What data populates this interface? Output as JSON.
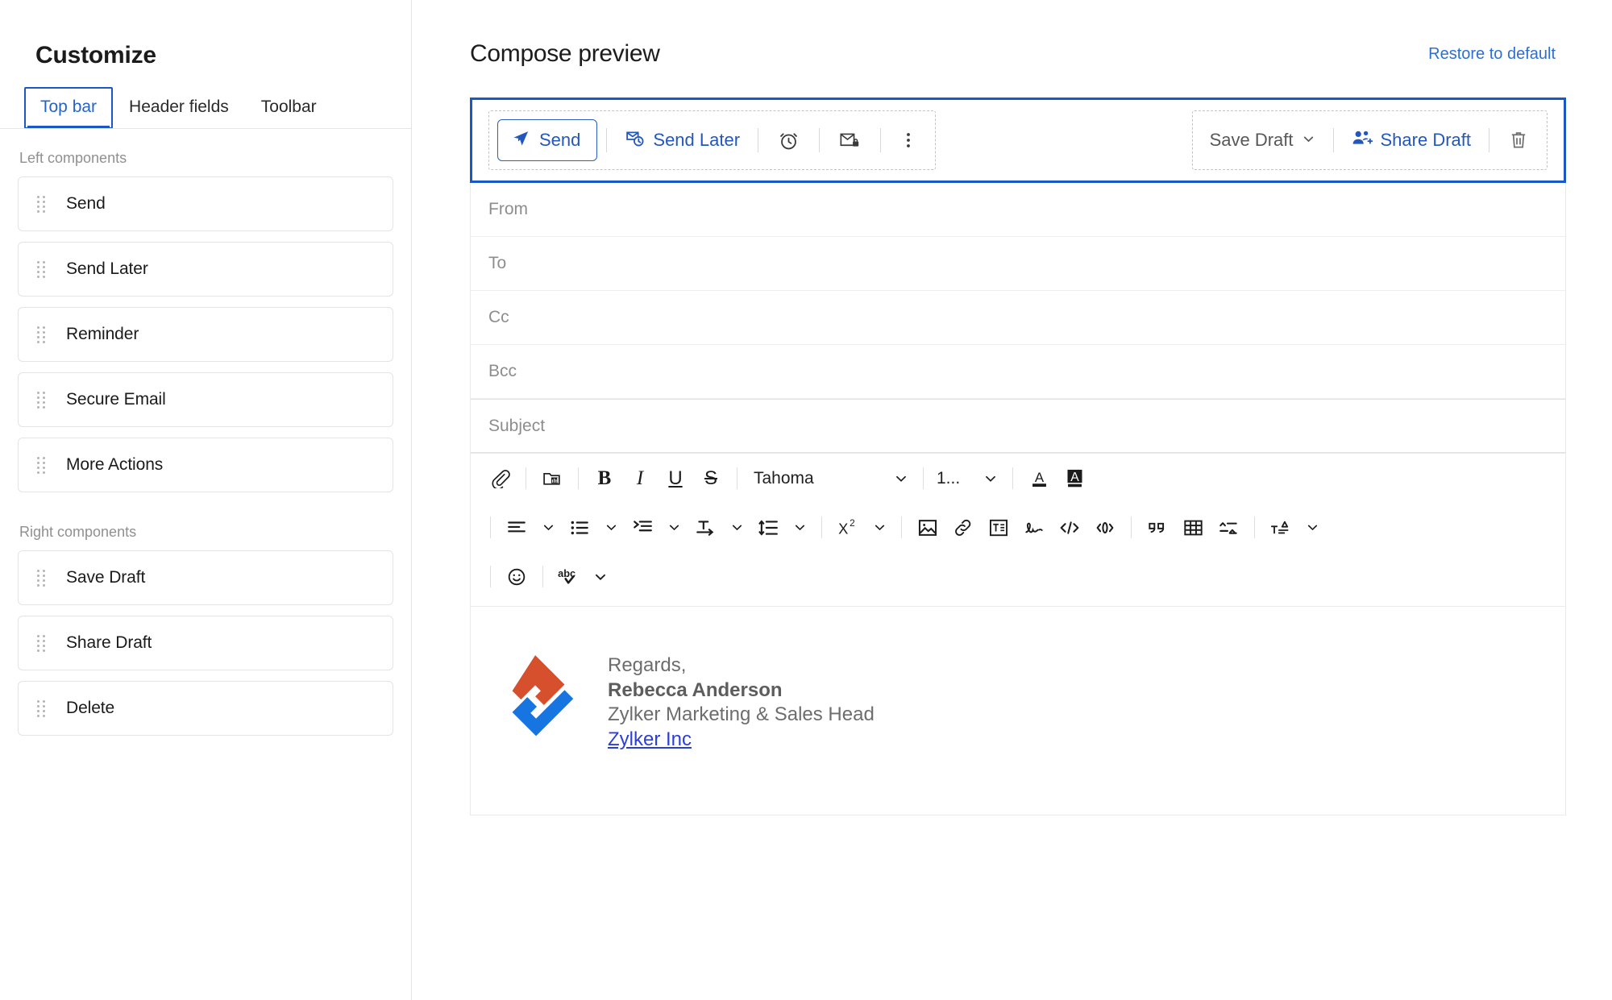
{
  "sidebar": {
    "title": "Customize",
    "tabs": [
      {
        "label": "Top bar",
        "active": true
      },
      {
        "label": "Header fields",
        "active": false
      },
      {
        "label": "Toolbar",
        "active": false
      }
    ],
    "left_components_label": "Left components",
    "left_components": [
      {
        "label": "Send"
      },
      {
        "label": "Send Later"
      },
      {
        "label": "Reminder"
      },
      {
        "label": "Secure Email"
      },
      {
        "label": "More Actions"
      }
    ],
    "right_components_label": "Right components",
    "right_components": [
      {
        "label": "Save Draft"
      },
      {
        "label": "Share Draft"
      },
      {
        "label": "Delete"
      }
    ]
  },
  "header": {
    "title": "Compose preview",
    "restore_label": "Restore to default"
  },
  "topbar": {
    "send_label": "Send",
    "send_later_label": "Send Later",
    "reminder_icon": "alarm-clock-icon",
    "secure_email_icon": "envelope-lock-icon",
    "more_actions_icon": "vertical-dots-icon",
    "save_draft_label": "Save Draft",
    "share_draft_label": "Share Draft",
    "delete_icon": "trash-icon",
    "accent_color": "#1a58c8",
    "link_color": "#2357bd",
    "muted_color": "#585858"
  },
  "fields": [
    {
      "label": "From"
    },
    {
      "label": "To"
    },
    {
      "label": "Cc"
    },
    {
      "label": "Bcc"
    },
    {
      "label": "Subject"
    }
  ],
  "editor": {
    "font_family_value": "Tahoma",
    "font_size_value": "1...",
    "row1_icons": [
      "attachment-icon",
      "insert-image-folder-icon",
      "bold-icon",
      "italic-icon",
      "underline-icon",
      "strikethrough-icon",
      "text-color-icon",
      "highlight-color-icon"
    ],
    "row2_icons": [
      "align-left-icon",
      "bulleted-list-icon",
      "indent-icon",
      "text-direction-icon",
      "line-spacing-icon",
      "superscript-icon",
      "insert-picture-icon",
      "insert-link-icon",
      "insert-template-icon",
      "signature-icon",
      "code-view-icon",
      "inline-code-icon",
      "blockquote-icon",
      "insert-table-icon",
      "sort-icon",
      "clear-formatting-icon"
    ],
    "row3_icons": [
      "emoji-icon",
      "spellcheck-icon"
    ]
  },
  "signature": {
    "greeting": "Regards,",
    "name": "Rebecca Anderson",
    "role": "Zylker Marketing & Sales Head",
    "company_link": "Zylker Inc",
    "logo_orange": "#d6502d",
    "logo_blue": "#1675e0"
  }
}
